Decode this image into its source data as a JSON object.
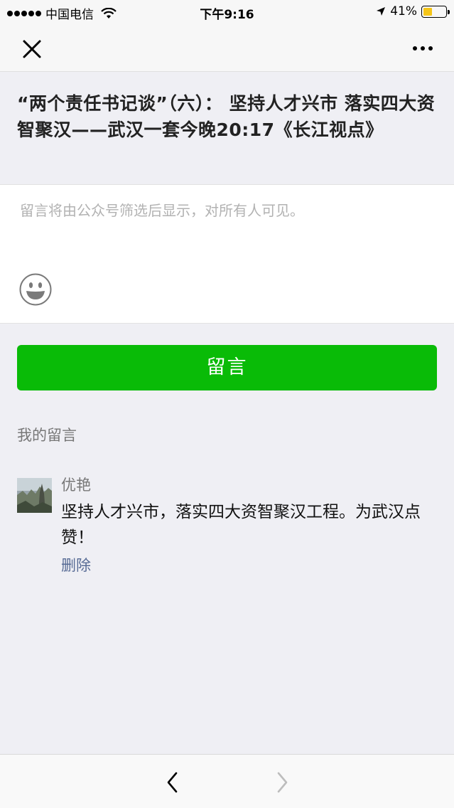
{
  "status_bar": {
    "carrier": "中国电信",
    "time": "下午9:16",
    "battery": "41%",
    "battery_level": 0.41
  },
  "nav": {
    "close_icon": "close-icon",
    "more_icon": "more-icon"
  },
  "article": {
    "title": "“两个责任书记谈”（六）： 坚持人才兴市 落实四大资智聚汉——武汉一套今晚20:17《长江视点》"
  },
  "comment_input": {
    "placeholder": "留言将由公众号筛选后显示，对所有人可见。",
    "emoji_icon": "emoji-icon"
  },
  "submit_button": {
    "label": "留言"
  },
  "my_comments": {
    "heading": "我的留言",
    "items": [
      {
        "name": "优艳",
        "text": "坚持人才兴市，落实四大资智聚汉工程。为武汉点赞！",
        "delete_label": "删除"
      }
    ]
  },
  "toolbar": {
    "back_icon": "chevron-left-icon",
    "forward_icon": "chevron-right-icon"
  },
  "colors": {
    "accent_green": "#09bb07",
    "link_blue": "#576b95",
    "battery_yellow": "#f5c518"
  }
}
